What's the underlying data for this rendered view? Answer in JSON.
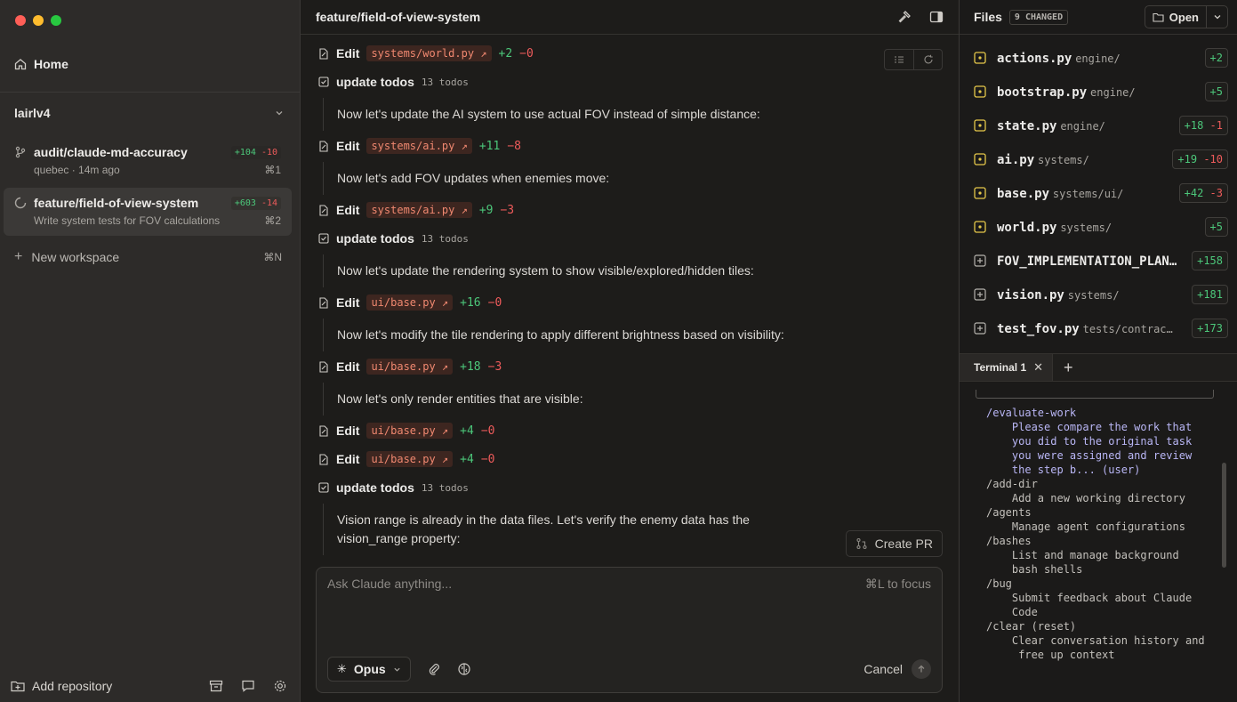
{
  "sidebar": {
    "home_label": "Home",
    "repo_name": "lairlv4",
    "workspaces": [
      {
        "title": "audit/claude-md-accuracy",
        "plus": "+104",
        "minus": "-10",
        "sub_left": "quebec · 14m ago",
        "shortcut": "⌘1"
      },
      {
        "title": "feature/field-of-view-system",
        "plus": "+603",
        "minus": "-14",
        "sub_left": "Write system tests for FOV calculations",
        "shortcut": "⌘2"
      }
    ],
    "new_workspace": "New workspace",
    "new_workspace_shortcut": "⌘N",
    "add_repository": "Add repository"
  },
  "center": {
    "title": "feature/field-of-view-system",
    "edit_label": "Edit",
    "todo_label": "update todos",
    "items": [
      {
        "type": "edit",
        "file": "systems/world.py ↗",
        "plus": "+2",
        "minus": "−0"
      },
      {
        "type": "todo",
        "count": "13 todos"
      },
      {
        "type": "msg",
        "text": "Now let's update the AI system to use actual FOV instead of simple distance:"
      },
      {
        "type": "edit",
        "file": "systems/ai.py ↗",
        "plus": "+11",
        "minus": "−8"
      },
      {
        "type": "msg",
        "text": "Now let's add FOV updates when enemies move:"
      },
      {
        "type": "edit",
        "file": "systems/ai.py ↗",
        "plus": "+9",
        "minus": "−3"
      },
      {
        "type": "todo",
        "count": "13 todos"
      },
      {
        "type": "msg",
        "text": "Now let's update the rendering system to show visible/explored/hidden tiles:"
      },
      {
        "type": "edit",
        "file": "ui/base.py ↗",
        "plus": "+16",
        "minus": "−0"
      },
      {
        "type": "msg",
        "text": "Now let's modify the tile rendering to apply different brightness based on visibility:"
      },
      {
        "type": "edit",
        "file": "ui/base.py ↗",
        "plus": "+18",
        "minus": "−3"
      },
      {
        "type": "msg",
        "text": "Now let's only render entities that are visible:"
      },
      {
        "type": "edit",
        "file": "ui/base.py ↗",
        "plus": "+4",
        "minus": "−0"
      },
      {
        "type": "edit",
        "file": "ui/base.py ↗",
        "plus": "+4",
        "minus": "−0"
      },
      {
        "type": "todo",
        "count": "13 todos"
      },
      {
        "type": "msg",
        "text": "Vision range is already in the data files. Let's verify the enemy data has the vision_range property:"
      }
    ],
    "create_pr": "Create PR",
    "composer_placeholder": "Ask Claude anything...",
    "composer_hint": "⌘L to focus",
    "model": "Opus",
    "cancel": "Cancel"
  },
  "files": {
    "title": "Files",
    "changed_badge": "9 CHANGED",
    "open_label": "Open",
    "list": [
      {
        "name": "actions.py",
        "dir": "engine/",
        "plus": "+2",
        "minus": "",
        "kind": "modified"
      },
      {
        "name": "bootstrap.py",
        "dir": "engine/",
        "plus": "+5",
        "minus": "",
        "kind": "modified"
      },
      {
        "name": "state.py",
        "dir": "engine/",
        "plus": "+18",
        "minus": "-1",
        "kind": "modified"
      },
      {
        "name": "ai.py",
        "dir": "systems/",
        "plus": "+19",
        "minus": "-10",
        "kind": "modified"
      },
      {
        "name": "base.py",
        "dir": "systems/ui/",
        "plus": "+42",
        "minus": "-3",
        "kind": "modified"
      },
      {
        "name": "world.py",
        "dir": "systems/",
        "plus": "+5",
        "minus": "",
        "kind": "modified"
      },
      {
        "name": "FOV_IMPLEMENTATION_PLAN…",
        "dir": "",
        "plus": "+158",
        "minus": "",
        "kind": "added"
      },
      {
        "name": "vision.py",
        "dir": "systems/",
        "plus": "+181",
        "minus": "",
        "kind": "added"
      },
      {
        "name": "test_fov.py",
        "dir": "tests/contrac…",
        "plus": "+173",
        "minus": "",
        "kind": "added"
      }
    ]
  },
  "terminal": {
    "tab": "Terminal 1",
    "lines": [
      {
        "text": "/evaluate-work",
        "hi": true
      },
      {
        "text": "    Please compare the work that",
        "hi": true
      },
      {
        "text": "    you did to the original task",
        "hi": true
      },
      {
        "text": "    you were assigned and review",
        "hi": true
      },
      {
        "text": "    the step b... (user)",
        "hi": true
      },
      {
        "text": "/add-dir",
        "hi": false
      },
      {
        "text": "    Add a new working directory",
        "hi": false
      },
      {
        "text": "/agents",
        "hi": false
      },
      {
        "text": "    Manage agent configurations",
        "hi": false
      },
      {
        "text": "/bashes",
        "hi": false
      },
      {
        "text": "    List and manage background",
        "hi": false
      },
      {
        "text": "    bash shells",
        "hi": false
      },
      {
        "text": "/bug",
        "hi": false
      },
      {
        "text": "    Submit feedback about Claude",
        "hi": false
      },
      {
        "text": "    Code",
        "hi": false
      },
      {
        "text": "/clear (reset)",
        "hi": false
      },
      {
        "text": "    Clear conversation history and",
        "hi": false
      },
      {
        "text": "     free up context",
        "hi": false
      }
    ]
  },
  "colors": {
    "accent_yellow": "#e5c84a",
    "plus": "#4cc77a",
    "minus": "#ee5b5b",
    "chip": "#f08870"
  }
}
